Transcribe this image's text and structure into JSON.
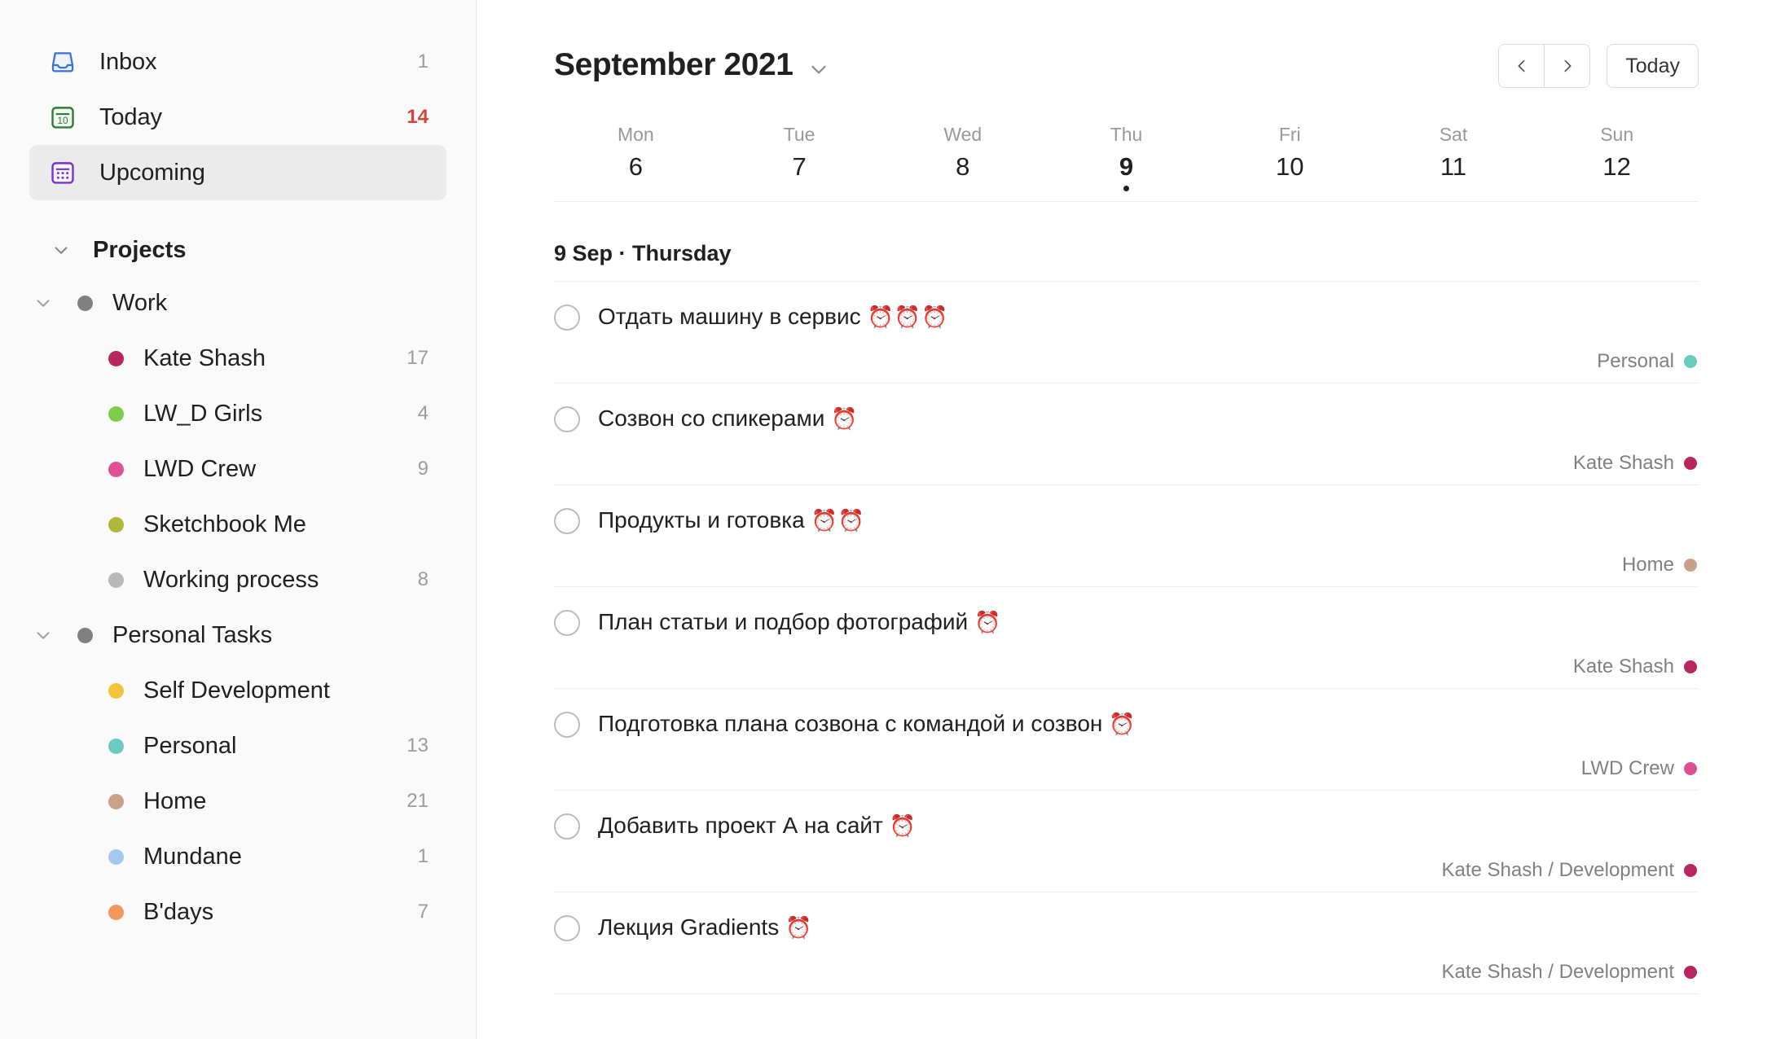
{
  "sidebar": {
    "nav": [
      {
        "label": "Inbox",
        "icon": "inbox-icon",
        "count": "1",
        "accent": false,
        "active": false
      },
      {
        "label": "Today",
        "icon": "calendar-today-icon",
        "count": "14",
        "accent": true,
        "active": false
      },
      {
        "label": "Upcoming",
        "icon": "calendar-upcoming-icon",
        "count": "",
        "accent": false,
        "active": true
      }
    ],
    "projects_section": {
      "title": "Projects",
      "groups": [
        {
          "label": "Work",
          "color": "#808080",
          "items": [
            {
              "label": "Kate Shash",
              "color": "#b8255f",
              "count": "17"
            },
            {
              "label": "LW_D Girls",
              "color": "#7ecc49",
              "count": "4"
            },
            {
              "label": "LWD Crew",
              "color": "#e05194",
              "count": "9"
            },
            {
              "label": "Sketchbook Me",
              "color": "#afb83b",
              "count": ""
            },
            {
              "label": "Working process",
              "color": "#b8b8b8",
              "count": "8"
            }
          ]
        },
        {
          "label": "Personal Tasks",
          "color": "#808080",
          "items": [
            {
              "label": "Self Development",
              "color": "#f0c53b",
              "count": ""
            },
            {
              "label": "Personal",
              "color": "#6accbc",
              "count": "13"
            },
            {
              "label": "Home",
              "color": "#c9a188",
              "count": "21"
            },
            {
              "label": "Mundane",
              "color": "#a5c8ed",
              "count": "1"
            },
            {
              "label": "B'days",
              "color": "#f0985b",
              "count": "7"
            }
          ]
        }
      ]
    }
  },
  "header": {
    "month_title": "September 2021",
    "prev_label": "‹",
    "next_label": "›",
    "today_label": "Today"
  },
  "week": [
    {
      "name": "Mon",
      "num": "6",
      "today": false
    },
    {
      "name": "Tue",
      "num": "7",
      "today": false
    },
    {
      "name": "Wed",
      "num": "8",
      "today": false
    },
    {
      "name": "Thu",
      "num": "9",
      "today": true
    },
    {
      "name": "Fri",
      "num": "10",
      "today": false
    },
    {
      "name": "Sat",
      "num": "11",
      "today": false
    },
    {
      "name": "Sun",
      "num": "12",
      "today": false
    }
  ],
  "day": {
    "title": "9 Sep · Thursday",
    "tasks": [
      {
        "text": "Отдать машину в сервис",
        "alarms": "⏰⏰⏰",
        "project": "Personal",
        "project_color": "#6accbc"
      },
      {
        "text": "Созвон со спикерами",
        "alarms": "⏰",
        "project": "Kate Shash",
        "project_color": "#b8255f"
      },
      {
        "text": "Продукты и готовка",
        "alarms": "⏰⏰",
        "project": "Home",
        "project_color": "#c9a188"
      },
      {
        "text": "План статьи и подбор фотографий",
        "alarms": "⏰",
        "project": "Kate Shash",
        "project_color": "#b8255f"
      },
      {
        "text": "Подготовка плана созвона с командой и созвон",
        "alarms": "⏰",
        "project": "LWD Crew",
        "project_color": "#e05194"
      },
      {
        "text": "Добавить проект А на сайт",
        "alarms": "⏰",
        "project": "Kate Shash / Development",
        "project_color": "#b8255f"
      },
      {
        "text": "Лекция Gradients",
        "alarms": "⏰",
        "project": "Kate Shash / Development",
        "project_color": "#b8255f"
      }
    ]
  }
}
